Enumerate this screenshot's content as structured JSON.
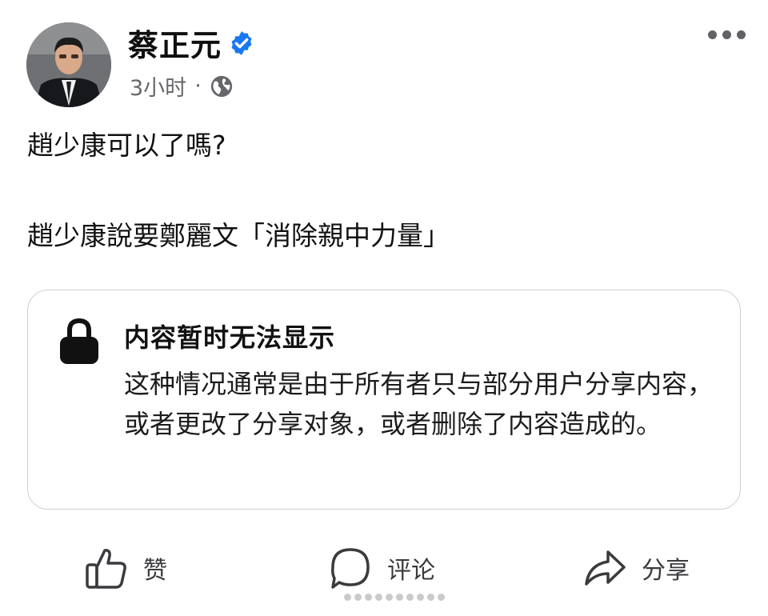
{
  "post": {
    "author_name": "蔡正元",
    "timestamp": "3小时",
    "separator": "·",
    "verified_icon": "verified-badge-icon",
    "audience_icon": "globe-icon",
    "menu_icon": "more-options-icon",
    "text_line_1": "趙少康可以了嗎?",
    "text_line_2": "趙少康說要鄭麗文「消除親中力量」"
  },
  "notice": {
    "icon": "lock-icon",
    "title": "内容暂时无法显示",
    "body": "这种情况通常是由于所有者只与部分用户分享内容，或者更改了分享对象，或者删除了内容造成的。"
  },
  "actions": {
    "like_label": "赞",
    "comment_label": "评论",
    "share_label": "分享"
  },
  "colors": {
    "verified_blue": "#1877f2",
    "meta_gray": "#65676b",
    "border_gray": "#cfd0d3"
  }
}
